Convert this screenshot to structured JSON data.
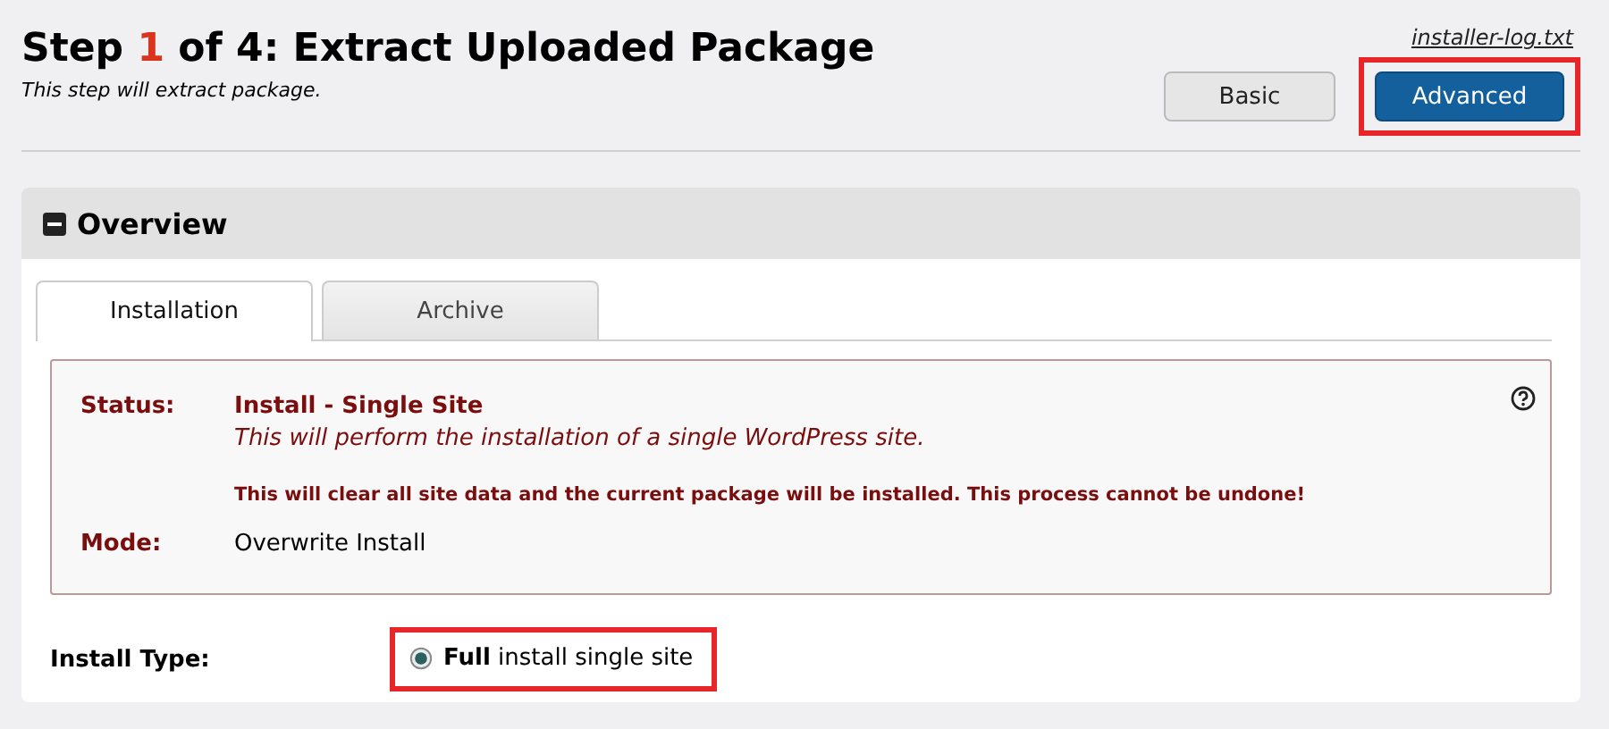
{
  "header": {
    "title_start": "Step",
    "step": "1",
    "title_end": "of 4: Extract Uploaded Package",
    "subtitle": "This step will extract package.",
    "log_link": "installer-log.txt"
  },
  "mode_buttons": [
    {
      "label": "Basic",
      "selected": false,
      "highlighted": false
    },
    {
      "label": "Advanced",
      "selected": true,
      "highlighted": true
    }
  ],
  "panel": {
    "title": "Overview",
    "expanded": true
  },
  "tabs": [
    {
      "label": "Installation",
      "selected": true
    },
    {
      "label": "Archive",
      "selected": false
    }
  ],
  "status_box": {
    "rows": [
      {
        "kind": "status",
        "label": "Status:",
        "value": "Install - Single Site",
        "description": "This will perform the installation of a single WordPress site.",
        "warning": "This will clear all site data and the current package will be installed. This process cannot be undone!"
      },
      {
        "kind": "plain",
        "label": "Mode:",
        "value": "Overwrite Install"
      }
    ]
  },
  "install_type": {
    "label": "Install Type:",
    "options": [
      {
        "bold": "Full",
        "text": "install single site",
        "selected": true,
        "highlighted": true
      }
    ]
  }
}
